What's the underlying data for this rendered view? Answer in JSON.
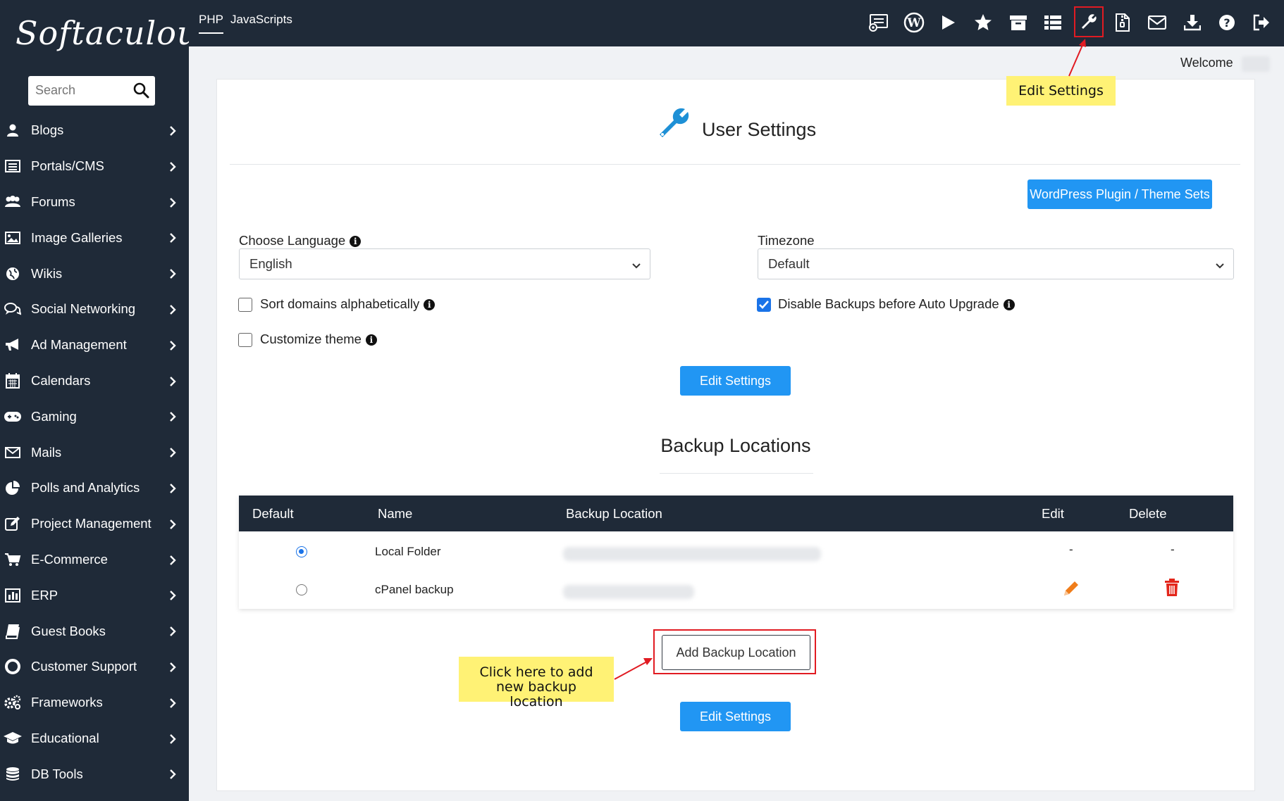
{
  "sidebar": {
    "logo": "Softaculous",
    "search_placeholder": "Search",
    "items": [
      {
        "label": "Blogs",
        "icon": "user-icon"
      },
      {
        "label": "Portals/CMS",
        "icon": "list-icon"
      },
      {
        "label": "Forums",
        "icon": "users-icon"
      },
      {
        "label": "Image Galleries",
        "icon": "image-icon"
      },
      {
        "label": "Wikis",
        "icon": "globe-icon"
      },
      {
        "label": "Social Networking",
        "icon": "comments-icon"
      },
      {
        "label": "Ad Management",
        "icon": "bullhorn-icon"
      },
      {
        "label": "Calendars",
        "icon": "calendar-icon"
      },
      {
        "label": "Gaming",
        "icon": "gamepad-icon"
      },
      {
        "label": "Mails",
        "icon": "envelope-icon"
      },
      {
        "label": "Polls and Analytics",
        "icon": "pie-chart-icon"
      },
      {
        "label": "Project Management",
        "icon": "edit-icon"
      },
      {
        "label": "E-Commerce",
        "icon": "cart-icon"
      },
      {
        "label": "ERP",
        "icon": "bar-chart-icon"
      },
      {
        "label": "Guest Books",
        "icon": "book-icon"
      },
      {
        "label": "Customer Support",
        "icon": "lifebuoy-icon"
      },
      {
        "label": "Frameworks",
        "icon": "gears-icon"
      },
      {
        "label": "Educational",
        "icon": "graduation-cap-icon"
      },
      {
        "label": "DB Tools",
        "icon": "database-icon"
      }
    ]
  },
  "topbar": {
    "tabs": [
      {
        "label": "PHP",
        "active": true
      },
      {
        "label": "JavaScripts",
        "active": false
      }
    ],
    "icons": [
      "installations-icon",
      "wordpress-icon",
      "play-icon",
      "star-icon",
      "archive-icon",
      "list-icon",
      "wrench-icon",
      "file-zip-icon",
      "envelope-icon",
      "download-icon",
      "help-icon",
      "logout-icon"
    ],
    "highlighted_icon": "wrench-icon"
  },
  "welcome": "Welcome",
  "callouts": {
    "edit_settings": "Edit Settings",
    "add_backup": "Click here to add new backup location"
  },
  "page": {
    "title": "User Settings",
    "wp_sets_button": "WordPress Plugin / Theme Sets",
    "language_label": "Choose Language",
    "language_value": "English",
    "timezone_label": "Timezone",
    "timezone_value": "Default",
    "sort_domains_label": "Sort domains alphabetically",
    "sort_domains_checked": false,
    "customize_theme_label": "Customize theme",
    "customize_theme_checked": false,
    "disable_backups_label": "Disable Backups before Auto Upgrade",
    "disable_backups_checked": true,
    "edit_settings_button": "Edit Settings"
  },
  "backup": {
    "title": "Backup Locations",
    "columns": [
      "Default",
      "Name",
      "Backup Location",
      "Edit",
      "Delete"
    ],
    "rows": [
      {
        "default": true,
        "name": "Local Folder",
        "edit": "-",
        "delete": "-"
      },
      {
        "default": false,
        "name": "cPanel backup",
        "edit": "pencil-icon",
        "delete": "trash-icon"
      }
    ],
    "add_button": "Add Backup Location",
    "edit_settings_button": "Edit Settings"
  },
  "colors": {
    "sidebar_bg": "#1f2a38",
    "primary": "#2196f3",
    "highlight_red": "#e11b22",
    "callout_yellow": "#fff275",
    "wrench_blue": "#1e90d6",
    "edit_orange": "#f07d1a",
    "delete_red": "#e3261b"
  }
}
